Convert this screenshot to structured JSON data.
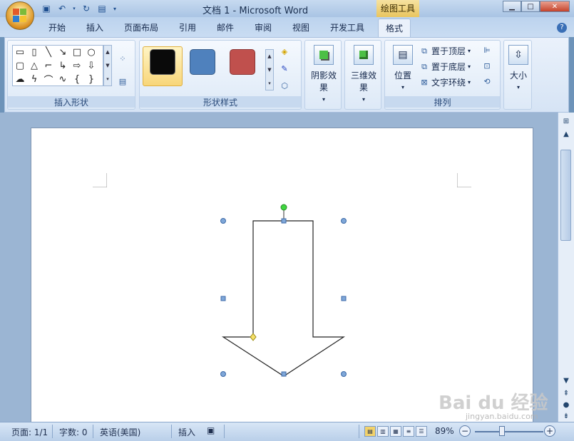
{
  "window": {
    "title": "文档 1 - Microsoft Word",
    "contextual_tab": "绘图工具"
  },
  "tabs": [
    {
      "label": "开始"
    },
    {
      "label": "插入"
    },
    {
      "label": "页面布局"
    },
    {
      "label": "引用"
    },
    {
      "label": "邮件"
    },
    {
      "label": "审阅"
    },
    {
      "label": "视图"
    },
    {
      "label": "开发工具"
    },
    {
      "label": "格式",
      "active": true
    }
  ],
  "ribbon": {
    "insert_shapes": {
      "label": "插入形状"
    },
    "shape_styles": {
      "label": "形状样式",
      "swatches": [
        "#0a0a0a",
        "#4f81bd",
        "#c0504d"
      ]
    },
    "shadow_effects": {
      "label": "阴影效果"
    },
    "effects_3d": {
      "label": "三维效果"
    },
    "arrange": {
      "label": "排列",
      "position": "位置",
      "bring_front": "置于顶层",
      "send_back": "置于底层",
      "text_wrap": "文字环绕"
    },
    "size": {
      "label": "大小"
    }
  },
  "document": {
    "shape": "down-arrow",
    "selected": true
  },
  "statusbar": {
    "page": "页面: 1/1",
    "words": "字数: 0",
    "language": "英语(美国)",
    "mode": "插入",
    "zoom": "89%"
  },
  "watermark": {
    "text": "Bai du 经验",
    "sub": "jingyan.baidu.com"
  }
}
